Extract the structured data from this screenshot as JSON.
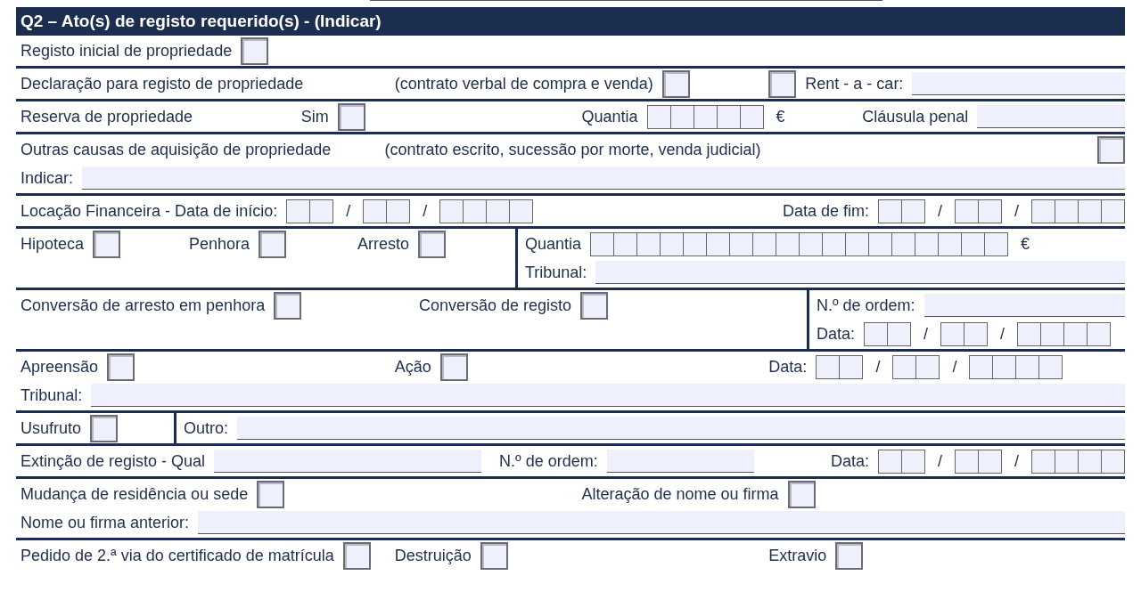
{
  "title": "Q2 – Ato(s) de registo requerido(s) -  (Indicar)",
  "rows": [
    {
      "cells": [
        {
          "kind": "main",
          "lines": [
            [
              {
                "items": [
                  {
                    "kind": "text",
                    "text": "Registo inicial de propriedade"
                  },
                  {
                    "kind": "checkbox",
                    "checked": false
                  }
                ]
              }
            ]
          ]
        }
      ]
    },
    {
      "cells": [
        {
          "kind": "main",
          "lines": [
            [
              {
                "items": [
                  {
                    "kind": "text",
                    "text": "Declaração para registo de propriedade"
                  }
                ]
              },
              {
                "items": [
                  {
                    "kind": "text",
                    "text": "(contrato verbal de compra e venda)"
                  },
                  {
                    "kind": "checkbox",
                    "checked": false
                  }
                ]
              },
              {
                "items": [
                  {
                    "kind": "checkbox",
                    "checked": false
                  },
                  {
                    "kind": "text",
                    "text": "Rent - a - car:"
                  },
                  {
                    "kind": "field"
                  }
                ]
              }
            ]
          ]
        }
      ]
    },
    {
      "cells": [
        {
          "kind": "main",
          "lines": [
            [
              {
                "items": [
                  {
                    "kind": "text",
                    "text": "Reserva de propriedade"
                  }
                ]
              },
              {
                "items": [
                  {
                    "kind": "text",
                    "text": "Sim"
                  },
                  {
                    "kind": "checkbox",
                    "checked": false
                  }
                ]
              },
              {
                "items": [
                  {
                    "kind": "text",
                    "text": "Quantia"
                  },
                  {
                    "kind": "digits-5"
                  },
                  {
                    "kind": "symbol",
                    "text": "€"
                  }
                ]
              },
              {
                "items": [
                  {
                    "kind": "text",
                    "text": "Cláusula penal"
                  },
                  {
                    "kind": "field"
                  }
                ]
              }
            ]
          ]
        }
      ]
    },
    {
      "cells": [
        {
          "kind": "main",
          "lines": [
            [
              {
                "items": [
                  {
                    "kind": "text",
                    "text": "Outras causas de aquisição de propriedade"
                  }
                ]
              },
              {
                "items": [
                  {
                    "kind": "text",
                    "text": "(contrato escrito, sucessão por morte, venda judicial)"
                  }
                ]
              },
              {
                "right": [
                  {
                    "kind": "checkbox",
                    "checked": false
                  }
                ]
              }
            ],
            [
              {
                "items": [
                  {
                    "kind": "text",
                    "text": "Indicar:"
                  },
                  {
                    "kind": "field"
                  }
                ]
              }
            ]
          ]
        }
      ]
    },
    {
      "cells": [
        {
          "kind": "main",
          "lines": [
            [
              {
                "items": [
                  {
                    "kind": "text",
                    "text": "Locação Financeira  -  Data de início:"
                  },
                  {
                    "kind": "digits-2"
                  },
                  {
                    "kind": "symbol",
                    "text": "/"
                  },
                  {
                    "kind": "digits-2"
                  },
                  {
                    "kind": "symbol",
                    "text": "/"
                  },
                  {
                    "kind": "digits-4"
                  }
                ]
              },
              {
                "right": [
                  {
                    "kind": "text",
                    "text": "Data de fim:"
                  },
                  {
                    "kind": "digits-2"
                  },
                  {
                    "kind": "symbol",
                    "text": "/"
                  },
                  {
                    "kind": "digits-2"
                  },
                  {
                    "kind": "symbol",
                    "text": "/"
                  },
                  {
                    "kind": "digits-4"
                  }
                ]
              }
            ]
          ]
        }
      ]
    },
    {
      "cells": [
        {
          "kind": "checks",
          "lines": [
            [
              {
                "items": [
                  {
                    "kind": "text",
                    "text": "Hipoteca"
                  },
                  {
                    "kind": "checkbox",
                    "checked": false
                  }
                ]
              },
              {
                "items": [
                  {
                    "kind": "text",
                    "text": "Penhora"
                  },
                  {
                    "kind": "checkbox",
                    "checked": false
                  }
                ]
              },
              {
                "items": [
                  {
                    "kind": "text",
                    "text": "Arresto"
                  },
                  {
                    "kind": "checkbox",
                    "checked": false
                  }
                ]
              }
            ]
          ]
        },
        {
          "kind": "rest",
          "lines": [
            [
              {
                "items": [
                  {
                    "kind": "text",
                    "text": "Quantia"
                  },
                  {
                    "kind": "digits-18"
                  },
                  {
                    "kind": "symbol",
                    "text": "€"
                  }
                ]
              }
            ],
            [
              {
                "items": [
                  {
                    "kind": "text",
                    "text": "Tribunal:"
                  },
                  {
                    "kind": "field"
                  }
                ]
              }
            ]
          ]
        }
      ]
    },
    {
      "cells": [
        {
          "kind": "conversions",
          "lines": [
            [
              {
                "items": [
                  {
                    "kind": "text",
                    "text": "Conversão de arresto em penhora"
                  },
                  {
                    "kind": "checkbox",
                    "checked": false
                  }
                ]
              },
              {
                "items": [
                  {
                    "kind": "text",
                    "text": "Conversão de registo"
                  },
                  {
                    "kind": "checkbox",
                    "checked": false
                  }
                ]
              }
            ]
          ]
        },
        {
          "kind": "rest",
          "lines": [
            [
              {
                "items": [
                  {
                    "kind": "text",
                    "text": "N.º de ordem:"
                  },
                  {
                    "kind": "field"
                  }
                ]
              }
            ],
            [
              {
                "items": [
                  {
                    "kind": "text",
                    "text": "Data:"
                  },
                  {
                    "kind": "digits-2"
                  },
                  {
                    "kind": "symbol",
                    "text": "/"
                  },
                  {
                    "kind": "digits-2"
                  },
                  {
                    "kind": "symbol",
                    "text": "/"
                  },
                  {
                    "kind": "digits-4"
                  }
                ]
              }
            ]
          ]
        }
      ]
    },
    {
      "cells": [
        {
          "kind": "main",
          "lines": [
            [
              {
                "items": [
                  {
                    "kind": "text",
                    "text": "Apreensão"
                  },
                  {
                    "kind": "checkbox",
                    "checked": false
                  }
                ]
              },
              {
                "items": [
                  {
                    "kind": "text",
                    "text": "Ação"
                  },
                  {
                    "kind": "checkbox",
                    "checked": false
                  }
                ]
              },
              {
                "items": [
                  {
                    "kind": "text",
                    "text": "Data:"
                  },
                  {
                    "kind": "digits-2"
                  },
                  {
                    "kind": "symbol",
                    "text": "/"
                  },
                  {
                    "kind": "digits-2"
                  },
                  {
                    "kind": "symbol",
                    "text": "/"
                  },
                  {
                    "kind": "digits-4"
                  }
                ]
              }
            ],
            [
              {
                "items": [
                  {
                    "kind": "text",
                    "text": "Tribunal:"
                  },
                  {
                    "kind": "field"
                  }
                ]
              }
            ]
          ]
        }
      ]
    },
    {
      "cells": [
        {
          "kind": "usufruct",
          "lines": [
            [
              {
                "items": [
                  {
                    "kind": "text",
                    "text": "Usufruto"
                  },
                  {
                    "kind": "checkbox",
                    "checked": false
                  }
                ]
              }
            ]
          ]
        },
        {
          "kind": "rest",
          "lines": [
            [
              {
                "items": [
                  {
                    "kind": "text",
                    "text": "Outro:"
                  },
                  {
                    "kind": "field"
                  }
                ]
              }
            ]
          ]
        }
      ]
    },
    {
      "cells": [
        {
          "kind": "main",
          "lines": [
            [
              {
                "items": [
                  {
                    "kind": "text",
                    "text": "Extinção de registo - Qual"
                  },
                  {
                    "kind": "field-medium"
                  }
                ]
              },
              {
                "items": [
                  {
                    "kind": "text",
                    "text": "N.º de ordem:"
                  },
                  {
                    "kind": "field-short"
                  }
                ]
              },
              {
                "right": [
                  {
                    "kind": "text",
                    "text": "Data:"
                  },
                  {
                    "kind": "digits-2"
                  },
                  {
                    "kind": "symbol",
                    "text": "/"
                  },
                  {
                    "kind": "digits-2"
                  },
                  {
                    "kind": "symbol",
                    "text": "/"
                  },
                  {
                    "kind": "digits-4"
                  }
                ]
              }
            ]
          ]
        }
      ]
    },
    {
      "cells": [
        {
          "kind": "main",
          "lines": [
            [
              {
                "items": [
                  {
                    "kind": "text",
                    "text": "Mudança de residência ou sede"
                  },
                  {
                    "kind": "checkbox",
                    "checked": false
                  }
                ]
              },
              {
                "items": [
                  {
                    "kind": "text",
                    "text": "Alteração de nome ou firma"
                  },
                  {
                    "kind": "checkbox",
                    "checked": false
                  }
                ]
              }
            ],
            [
              {
                "items": [
                  {
                    "kind": "text",
                    "text": "Nome ou firma anterior:"
                  },
                  {
                    "kind": "field"
                  }
                ]
              }
            ]
          ]
        }
      ]
    },
    {
      "cells": [
        {
          "kind": "main",
          "lines": [
            [
              {
                "items": [
                  {
                    "kind": "text",
                    "text": "Pedido de 2.ª via do certificado de matrícula"
                  },
                  {
                    "kind": "checkbox",
                    "checked": false
                  }
                ]
              },
              {
                "items": [
                  {
                    "kind": "text",
                    "text": "Destruição"
                  },
                  {
                    "kind": "checkbox",
                    "checked": false
                  }
                ]
              },
              {
                "items": [
                  {
                    "kind": "text",
                    "text": "Extravio"
                  },
                  {
                    "kind": "checkbox",
                    "checked": false
                  }
                ]
              }
            ]
          ]
        }
      ]
    }
  ]
}
